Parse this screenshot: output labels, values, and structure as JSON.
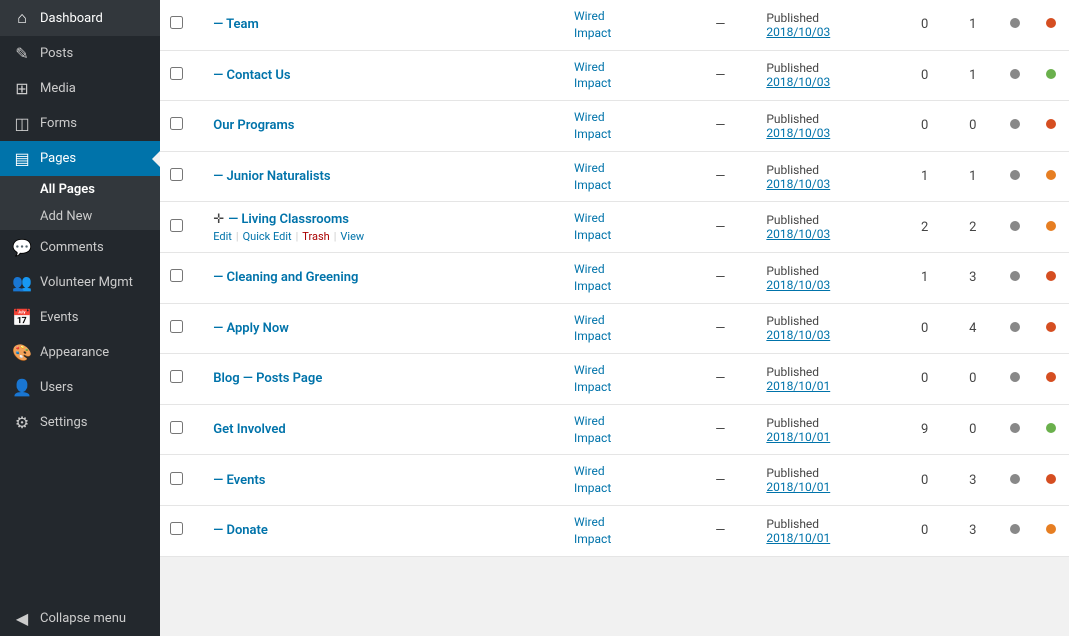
{
  "sidebar": {
    "items": [
      {
        "id": "dashboard",
        "label": "Dashboard",
        "icon": "⌂",
        "active": false
      },
      {
        "id": "posts",
        "label": "Posts",
        "icon": "✎",
        "active": false
      },
      {
        "id": "media",
        "label": "Media",
        "icon": "⊞",
        "active": false
      },
      {
        "id": "forms",
        "label": "Forms",
        "icon": "◫",
        "active": false
      },
      {
        "id": "pages",
        "label": "Pages",
        "icon": "▤",
        "active": true
      }
    ],
    "pages_subitems": [
      {
        "id": "all-pages",
        "label": "All Pages",
        "active": true
      },
      {
        "id": "add-new",
        "label": "Add New",
        "active": false
      }
    ],
    "bottom_items": [
      {
        "id": "comments",
        "label": "Comments",
        "icon": "💬"
      },
      {
        "id": "volunteer-mgmt",
        "label": "Volunteer Mgmt",
        "icon": "👥"
      },
      {
        "id": "events",
        "label": "Events",
        "icon": "📅"
      },
      {
        "id": "appearance",
        "label": "Appearance",
        "icon": "🎨"
      },
      {
        "id": "users",
        "label": "Users",
        "icon": "👤"
      },
      {
        "id": "settings",
        "label": "Settings",
        "icon": "⚙"
      },
      {
        "id": "collapse",
        "label": "Collapse menu",
        "icon": "◀"
      }
    ]
  },
  "table": {
    "rows": [
      {
        "id": "row-team",
        "title": "— Team",
        "indent": true,
        "theme_line1": "Wired",
        "theme_line2": "Impact",
        "author": "—",
        "status": "Published",
        "date": "2018/10/03",
        "c1": "0",
        "c2": "1",
        "dot1_color": "gray",
        "dot2_color": "red",
        "row_actions": []
      },
      {
        "id": "row-contact",
        "title": "— Contact Us",
        "indent": true,
        "theme_line1": "Wired",
        "theme_line2": "Impact",
        "author": "—",
        "status": "Published",
        "date": "2018/10/03",
        "c1": "0",
        "c2": "1",
        "dot1_color": "gray",
        "dot2_color": "green",
        "row_actions": []
      },
      {
        "id": "row-programs",
        "title": "Our Programs",
        "indent": false,
        "theme_line1": "Wired",
        "theme_line2": "Impact",
        "author": "—",
        "status": "Published",
        "date": "2018/10/03",
        "c1": "0",
        "c2": "0",
        "dot1_color": "gray",
        "dot2_color": "red",
        "row_actions": []
      },
      {
        "id": "row-junior",
        "title": "— Junior Naturalists",
        "indent": true,
        "theme_line1": "Wired",
        "theme_line2": "Impact",
        "author": "—",
        "status": "Published",
        "date": "2018/10/03",
        "c1": "1",
        "c2": "1",
        "dot1_color": "gray",
        "dot2_color": "orange",
        "row_actions": []
      },
      {
        "id": "row-living",
        "title": "— Living Classrooms",
        "indent": true,
        "theme_line1": "Wired",
        "theme_line2": "Impact",
        "author": "—",
        "status": "Published",
        "date": "2018/10/03",
        "c1": "2",
        "c2": "2",
        "dot1_color": "gray",
        "dot2_color": "orange",
        "row_actions": [
          {
            "id": "edit",
            "label": "Edit",
            "type": "edit"
          },
          {
            "id": "quick-edit",
            "label": "Quick Edit",
            "type": "quick"
          },
          {
            "id": "trash",
            "label": "Trash",
            "type": "trash"
          },
          {
            "id": "view",
            "label": "View",
            "type": "view"
          }
        ],
        "show_drag": true
      },
      {
        "id": "row-cleaning",
        "title": "— Cleaning and Greening",
        "indent": true,
        "theme_line1": "Wired",
        "theme_line2": "Impact",
        "author": "—",
        "status": "Published",
        "date": "2018/10/03",
        "c1": "1",
        "c2": "3",
        "dot1_color": "gray",
        "dot2_color": "red",
        "row_actions": []
      },
      {
        "id": "row-apply",
        "title": "— Apply Now",
        "indent": true,
        "theme_line1": "Wired",
        "theme_line2": "Impact",
        "author": "—",
        "status": "Published",
        "date": "2018/10/03",
        "c1": "0",
        "c2": "4",
        "dot1_color": "gray",
        "dot2_color": "red",
        "row_actions": []
      },
      {
        "id": "row-blog",
        "title": "Blog — Posts Page",
        "indent": false,
        "theme_line1": "Wired",
        "theme_line2": "Impact",
        "author": "—",
        "status": "Published",
        "date": "2018/10/01",
        "c1": "0",
        "c2": "0",
        "dot1_color": "gray",
        "dot2_color": "red",
        "row_actions": []
      },
      {
        "id": "row-get-involved",
        "title": "Get Involved",
        "indent": false,
        "theme_line1": "Wired",
        "theme_line2": "Impact",
        "author": "—",
        "status": "Published",
        "date": "2018/10/01",
        "c1": "9",
        "c2": "0",
        "dot1_color": "gray",
        "dot2_color": "green",
        "row_actions": []
      },
      {
        "id": "row-events",
        "title": "— Events",
        "indent": true,
        "theme_line1": "Wired",
        "theme_line2": "Impact",
        "author": "—",
        "status": "Published",
        "date": "2018/10/01",
        "c1": "0",
        "c2": "3",
        "dot1_color": "gray",
        "dot2_color": "red",
        "row_actions": []
      },
      {
        "id": "row-donate",
        "title": "— Donate",
        "indent": true,
        "theme_line1": "Wired",
        "theme_line2": "Impact",
        "author": "—",
        "status": "Published",
        "date": "2018/10/01",
        "c1": "0",
        "c2": "3",
        "dot1_color": "gray",
        "dot2_color": "orange",
        "row_actions": []
      }
    ]
  }
}
